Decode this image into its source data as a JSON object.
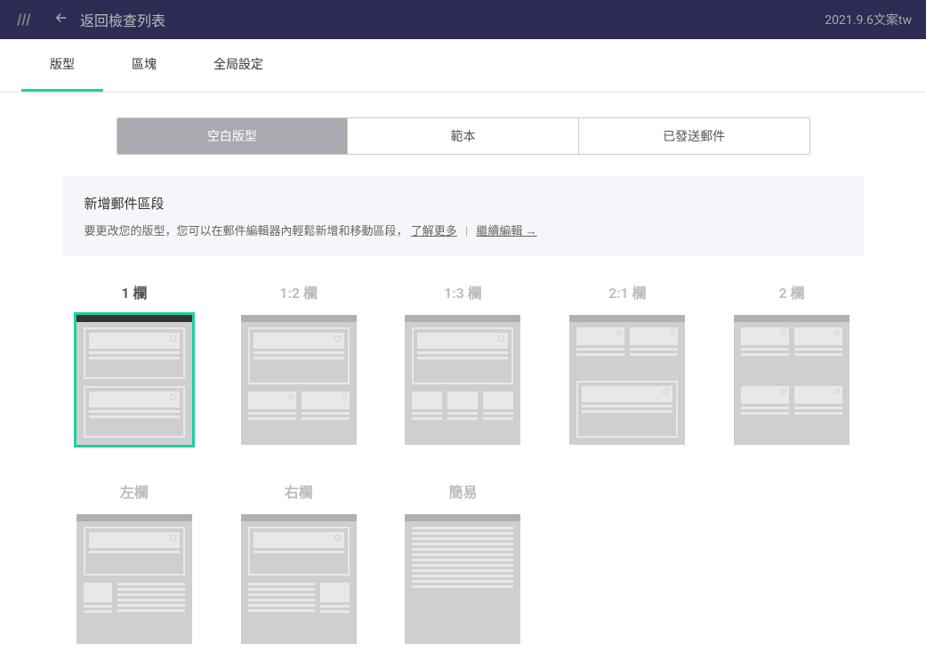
{
  "topbar": {
    "back_label": "返回檢查列表",
    "project_title": "2021.9.6文案tw"
  },
  "tabs": {
    "layout": "版型",
    "blocks": "區塊",
    "global": "全局設定"
  },
  "segmented": {
    "blank": "空白版型",
    "template": "範本",
    "sent": "已發送郵件"
  },
  "notice": {
    "title": "新增郵件區段",
    "text": "要更改您的版型，您可以在郵件編輯器內輕鬆新增和移動區段，",
    "learn_more": "了解更多",
    "continue_edit": "繼續編輯 →"
  },
  "layouts": {
    "col1": "1 欄",
    "col12": "1:2 欄",
    "col13": "1:3 欄",
    "col21": "2:1 欄",
    "col2": "2 欄",
    "left": "左欄",
    "right": "右欄",
    "simple": "簡易"
  }
}
